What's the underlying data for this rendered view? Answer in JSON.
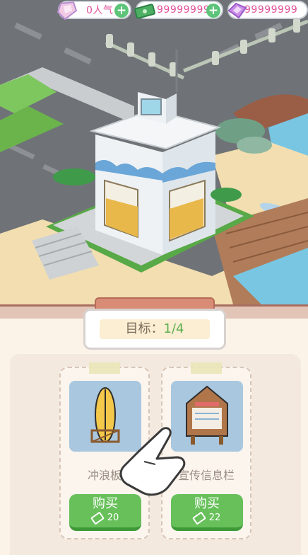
{
  "topbar": {
    "popularity": "0人气",
    "cash": "99999999",
    "gems": "99999999"
  },
  "goal": {
    "label": "目标：",
    "progress": "1/4"
  },
  "items": [
    {
      "name": "冲浪板",
      "buy_label": "购买",
      "price": "20",
      "icon": "surfboard-icon"
    },
    {
      "name": "宣传信息栏",
      "buy_label": "购买",
      "price": "22",
      "icon": "bulletin-board-icon"
    }
  ],
  "colors": {
    "buy_green": "#67c05a",
    "plus_green": "#5dc47a",
    "currency_text": "#e0529b",
    "goal_count": "#5dae4f"
  }
}
